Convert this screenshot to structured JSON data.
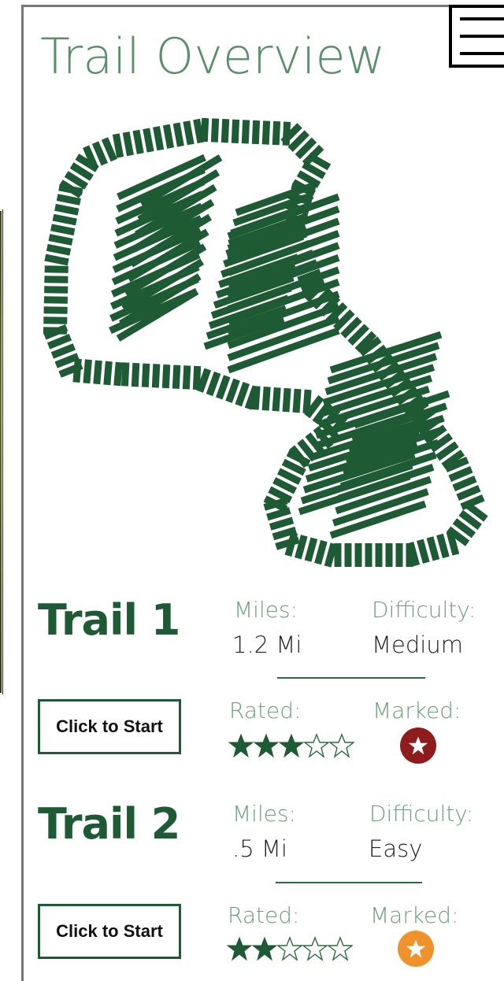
{
  "page": {
    "title": "Trail Overview"
  },
  "trails": [
    {
      "name": "Trail 1",
      "miles_label": "Miles:",
      "miles_value": "1.2 Mi",
      "difficulty_label": "Difficulty:",
      "difficulty_value": "Medium",
      "rated_label": "Rated:",
      "rating": 3,
      "rating_max": 5,
      "marked_label": "Marked:",
      "marker_color": "#8e1c1c",
      "start_label": "Click to Start"
    },
    {
      "name": "Trail 2",
      "miles_label": "Miles:",
      "miles_value": ".5 Mi",
      "difficulty_label": "Difficulty:",
      "difficulty_value": "Easy",
      "rated_label": "Rated:",
      "rating": 2,
      "rating_max": 5,
      "marked_label": "Marked:",
      "marker_color": "#f0922b",
      "start_label": "Click to Start"
    }
  ],
  "icons": {
    "menu": "hamburger-menu-icon",
    "map": "trail-map-icon",
    "rating": "star-icon",
    "marker": "star-badge-icon"
  },
  "colors": {
    "accent": "#1e5b34",
    "title": "#5a8f6c",
    "label": "#6c9f7c"
  }
}
